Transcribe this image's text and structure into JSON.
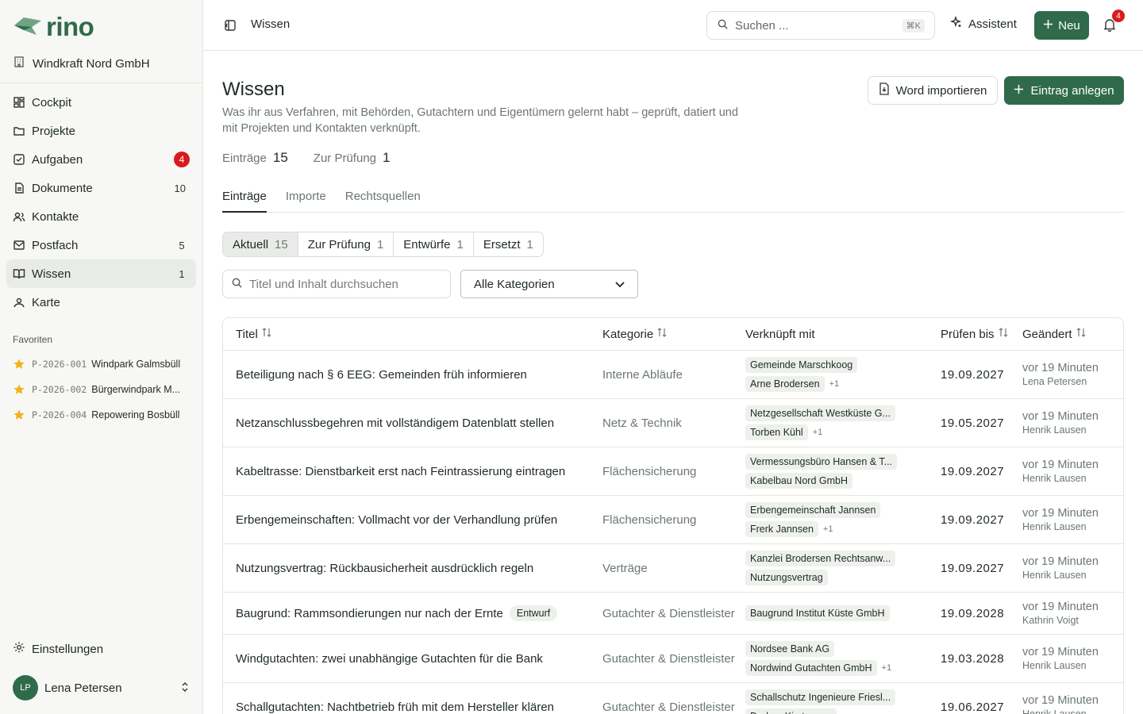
{
  "brand": {
    "name": "rino",
    "accent": "#2f6b4a",
    "alert": "#d81b1b"
  },
  "org": {
    "name": "Windkraft Nord GmbH",
    "icon": "building-icon"
  },
  "nav": [
    {
      "key": "cockpit",
      "label": "Cockpit",
      "icon": "dashboard-icon",
      "count": ""
    },
    {
      "key": "projekte",
      "label": "Projekte",
      "icon": "folder-icon",
      "count": ""
    },
    {
      "key": "aufgaben",
      "label": "Aufgaben",
      "icon": "checkbox-icon",
      "count": "4"
    },
    {
      "key": "dokumente",
      "label": "Dokumente",
      "icon": "document-icon",
      "count": "10"
    },
    {
      "key": "kontakte",
      "label": "Kontakte",
      "icon": "contacts-icon",
      "count": ""
    },
    {
      "key": "postfach",
      "label": "Postfach",
      "icon": "mail-icon",
      "count": "5"
    },
    {
      "key": "wissen",
      "label": "Wissen",
      "icon": "book-icon",
      "count": "1"
    },
    {
      "key": "karte",
      "label": "Karte",
      "icon": "map-pin-icon",
      "count": ""
    }
  ],
  "favorites": {
    "title": "Favoriten",
    "items": [
      {
        "code": "P-2026-001",
        "name": "Windpark Galmsbüll"
      },
      {
        "code": "P-2026-002",
        "name": "Bürgerwindpark M..."
      },
      {
        "code": "P-2026-004",
        "name": "Repowering Bosbüll"
      }
    ]
  },
  "settings_label": "Einstellungen",
  "user": {
    "initials": "LP",
    "name": "Lena Petersen"
  },
  "topbar": {
    "breadcrumb": "Wissen",
    "search_placeholder": "Suchen ...",
    "search_shortcut": "⌘K",
    "assistant_label": "Assistent",
    "new_label": "Neu",
    "notifications": "4"
  },
  "page": {
    "title": "Wissen",
    "description": "Was ihr aus Verfahren, mit Behörden, Gutachtern und Eigentümern gelernt habt – geprüft, datiert und mit Projekten und Kontakten verknüpft.",
    "import_button": "Word importieren",
    "create_button": "Eintrag anlegen",
    "stats": [
      {
        "label": "Einträge",
        "value": "15"
      },
      {
        "label": "Zur Prüfung",
        "value": "1"
      }
    ],
    "tabs": [
      "Einträge",
      "Importe",
      "Rechtsquellen"
    ],
    "segments": [
      {
        "label": "Aktuell",
        "count": "15"
      },
      {
        "label": "Zur Prüfung",
        "count": "1"
      },
      {
        "label": "Entwürfe",
        "count": "1"
      },
      {
        "label": "Ersetzt",
        "count": "1"
      }
    ],
    "filter_placeholder": "Titel und Inhalt durchsuchen",
    "category_select": "Alle Kategorien"
  },
  "table": {
    "columns": [
      "Titel",
      "Kategorie",
      "Verknüpft mit",
      "Prüfen bis",
      "Geändert"
    ],
    "rows": [
      {
        "title": "Beteiligung nach § 6 EEG: Gemeinden früh informieren",
        "badge": "",
        "category": "Interne Abläufe",
        "links": [
          "Gemeinde Marschkoog",
          "Arne Brodersen"
        ],
        "more": "+1",
        "due": "19.09.2027",
        "changed": "vor 19 Minuten",
        "by": "Lena Petersen"
      },
      {
        "title": "Netzanschlussbegehren mit vollständigem Datenblatt stellen",
        "badge": "",
        "category": "Netz & Technik",
        "links": [
          "Netzgesellschaft Westküste G...",
          "Torben Kühl"
        ],
        "more": "+1",
        "due": "19.05.2027",
        "changed": "vor 19 Minuten",
        "by": "Henrik Lausen"
      },
      {
        "title": "Kabeltrasse: Dienstbarkeit erst nach Feintrassierung eintragen",
        "badge": "",
        "category": "Flächensicherung",
        "links": [
          "Vermessungsbüro Hansen & T...",
          "Kabelbau Nord GmbH"
        ],
        "more": "",
        "due": "19.09.2027",
        "changed": "vor 19 Minuten",
        "by": "Henrik Lausen"
      },
      {
        "title": "Erbengemeinschaften: Vollmacht vor der Verhandlung prüfen",
        "badge": "",
        "category": "Flächensicherung",
        "links": [
          "Erbengemeinschaft Jannsen",
          "Frerk Jannsen"
        ],
        "more": "+1",
        "due": "19.09.2027",
        "changed": "vor 19 Minuten",
        "by": "Henrik Lausen"
      },
      {
        "title": "Nutzungsvertrag: Rückbausicherheit ausdrücklich regeln",
        "badge": "",
        "category": "Verträge",
        "links": [
          "Kanzlei Brodersen Rechtsanw...",
          "Nutzungsvertrag"
        ],
        "more": "",
        "due": "19.09.2027",
        "changed": "vor 19 Minuten",
        "by": "Henrik Lausen"
      },
      {
        "title": "Baugrund: Rammsondierungen nur nach der Ernte",
        "badge": "Entwurf",
        "category": "Gutachter & Dienstleister",
        "links": [
          "Baugrund Institut Küste GmbH"
        ],
        "more": "",
        "due": "19.09.2028",
        "changed": "vor 19 Minuten",
        "by": "Kathrin Voigt"
      },
      {
        "title": "Windgutachten: zwei unabhängige Gutachten für die Bank",
        "badge": "",
        "category": "Gutachter & Dienstleister",
        "links": [
          "Nordsee Bank AG",
          "Nordwind Gutachten GmbH"
        ],
        "more": "+1",
        "due": "19.03.2028",
        "changed": "vor 19 Minuten",
        "by": "Henrik Lausen"
      },
      {
        "title": "Schallgutachten: Nachtbetrieb früh mit dem Hersteller klären",
        "badge": "",
        "category": "Gutachter & Dienstleister",
        "links": [
          "Schallschutz Ingenieure Friesl...",
          "Dedam Kirstensen"
        ],
        "more": "",
        "due": "19.06.2027",
        "changed": "vor 19 Minuten",
        "by": "Henrik Lausen"
      }
    ]
  }
}
